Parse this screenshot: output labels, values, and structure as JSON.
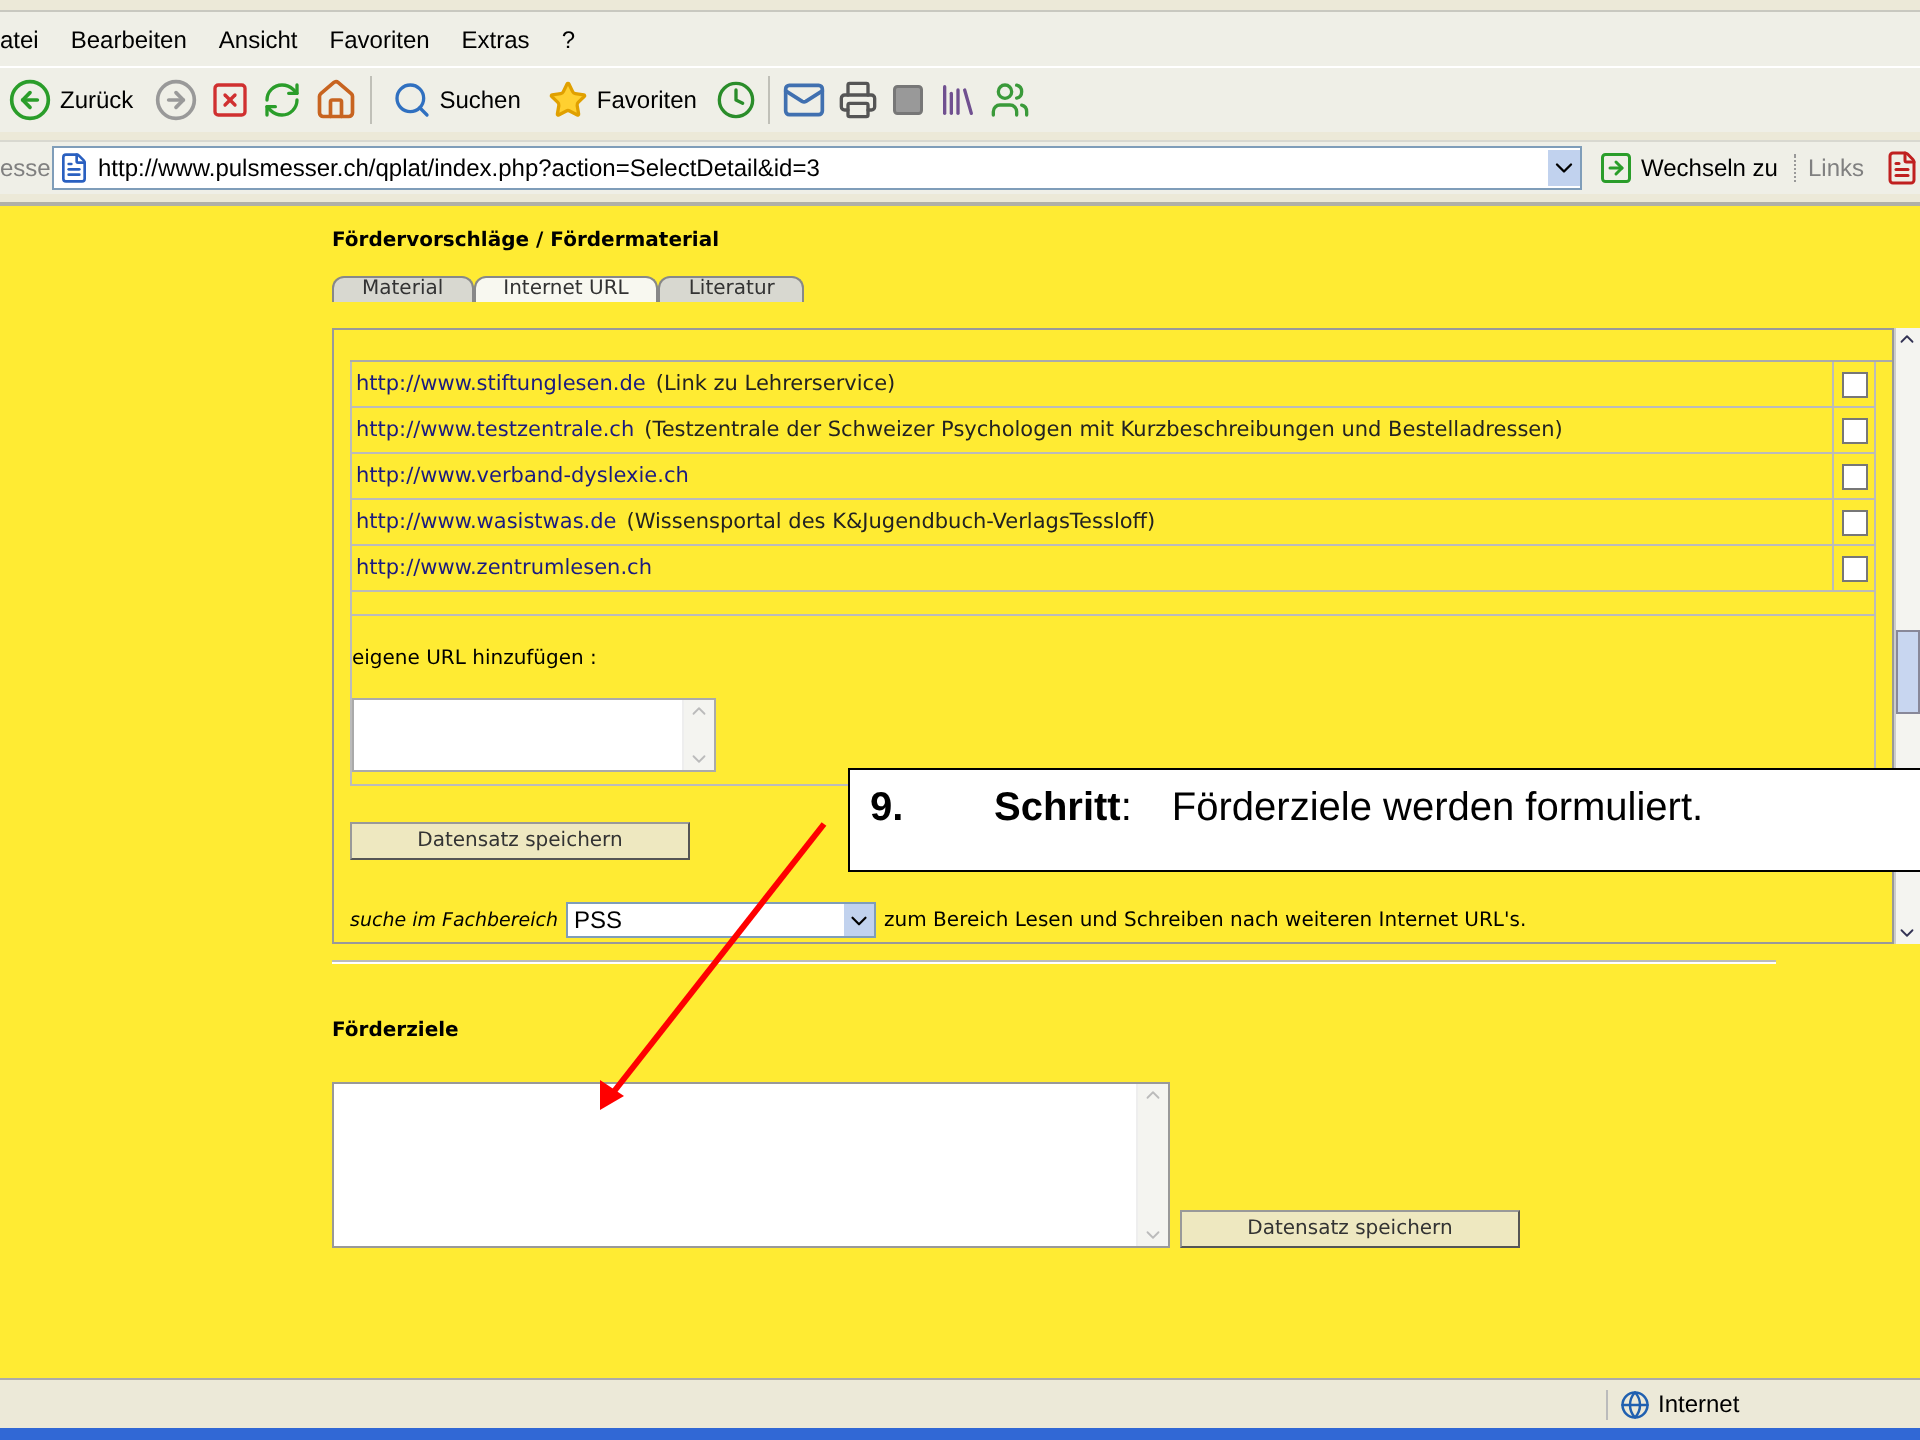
{
  "menu_bar": [
    "atei",
    "Bearbeiten",
    "Ansicht",
    "Favoriten",
    "Extras",
    "?"
  ],
  "toolbar": {
    "back": "Zurück",
    "search": "Suchen",
    "favorites": "Favoriten"
  },
  "address_bar": {
    "label": "esse",
    "url": "http://www.pulsmesser.ch/qplat/index.php?action=SelectDetail&id=3",
    "go": "Wechseln zu",
    "links": "Links"
  },
  "section_title": "Fördervorschläge / Fördermaterial",
  "tabs": [
    {
      "label": "Material",
      "selected": false
    },
    {
      "label": "Internet URL",
      "selected": true
    },
    {
      "label": "Literatur",
      "selected": false
    }
  ],
  "url_list": [
    {
      "url": "http://www.stiftunglesen.de",
      "note": "(Link zu Lehrerservice)",
      "checked": false
    },
    {
      "url": "http://www.testzentrale.ch",
      "note": "(Testzentrale der Schweizer Psychologen mit Kurzbeschreibungen und Bestelladressen)",
      "checked": false
    },
    {
      "url": "http://www.verband-dyslexie.ch",
      "checked": false
    },
    {
      "url": "http://www.wasistwas.de",
      "note": "(Wissensportal des K&Jugendbuch-VerlagsTessloff)",
      "checked": false
    },
    {
      "url": "http://www.zentrumlesen.ch",
      "checked": false
    }
  ],
  "own_url": {
    "label": "eigene URL hinzufügen :",
    "save": "Datensatz speichern"
  },
  "search_row": {
    "label": "suche im Fachbereich",
    "value": "PSS",
    "suffix": "zum Bereich Lesen und Schreiben nach weiteren Internet URL's."
  },
  "goals": {
    "title": "Förderziele",
    "save": "Datensatz speichern"
  },
  "callout": {
    "number": "9.",
    "word": "Schritt",
    "separator": ":",
    "text": "Förderziele werden formuliert."
  },
  "status_bar": {
    "zone": "Internet"
  }
}
